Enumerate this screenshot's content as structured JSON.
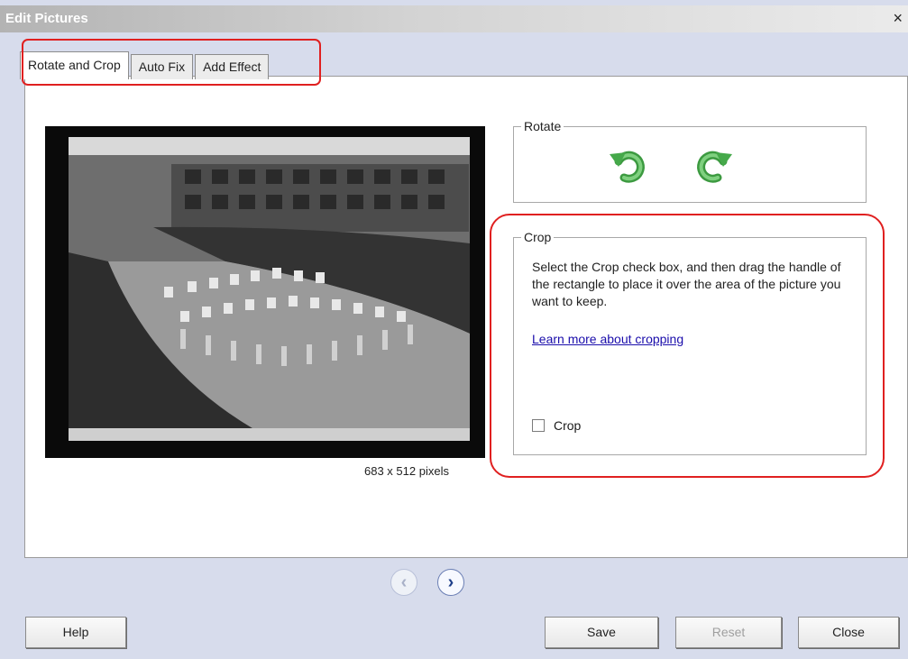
{
  "window": {
    "title": "Edit Pictures",
    "close_label": "×"
  },
  "tabs": [
    {
      "label": "Rotate and Crop",
      "active": true
    },
    {
      "label": "Auto Fix",
      "active": false
    },
    {
      "label": "Add Effect",
      "active": false
    }
  ],
  "preview": {
    "caption": "683 x 512 pixels"
  },
  "rotate": {
    "legend": "Rotate",
    "buttons": [
      {
        "name": "rotate-left",
        "icon": "rotate-counterclockwise-icon"
      },
      {
        "name": "rotate-right",
        "icon": "rotate-clockwise-icon"
      }
    ]
  },
  "crop": {
    "legend": "Crop",
    "instructions": "Select the Crop check box, and then drag the handle of the rectangle to place it over the area of the picture you want to keep.",
    "link": "Learn more about cropping",
    "checkbox_label": "Crop",
    "checked": false
  },
  "navigation": {
    "prev_icon": "‹",
    "next_icon": "›"
  },
  "buttons": {
    "help": "Help",
    "save": "Save",
    "reset": "Reset",
    "close": "Close"
  },
  "colors": {
    "highlight": "#e02020",
    "rotate_green": "#45a94a",
    "link": "#1a0dab"
  }
}
